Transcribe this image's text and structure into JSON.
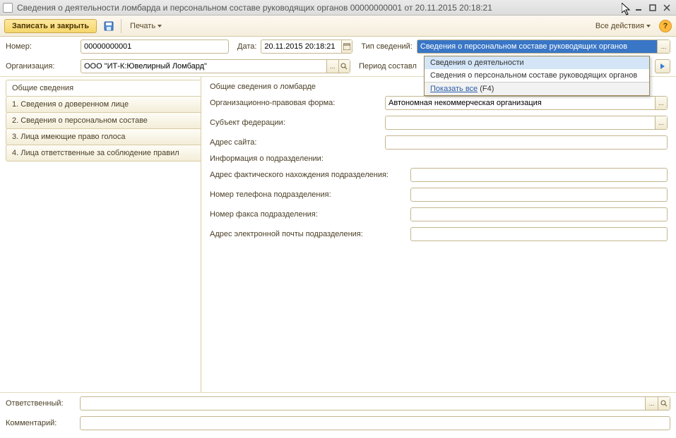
{
  "title": "Сведения о деятельности ломбарда и персональном составе руководящих органов 00000000001 от 20.11.2015 20:18:21",
  "toolbar": {
    "save_close": "Записать и закрыть",
    "print": "Печать",
    "all_actions": "Все действия"
  },
  "filters": {
    "number_label": "Номер:",
    "number_value": "00000000001",
    "date_label": "Дата:",
    "date_value": "20.11.2015 20:18:21",
    "type_label": "Тип сведений:",
    "type_value": "Сведения о персональном составе руководящих органов",
    "org_label": "Организация:",
    "org_value": "ООО \"ИТ-К:Ювелирный Ломбард\"",
    "period_label": "Период составл"
  },
  "tabs": [
    {
      "label": "Общие сведения"
    },
    {
      "label": "1. Сведения о доверенном лице"
    },
    {
      "label": "2. Сведения о персональном составе"
    },
    {
      "label": "3. Лица имеющие право голоса"
    },
    {
      "label": "4. Лица ответственные за соблюдение правил"
    }
  ],
  "form": {
    "header": "Общие сведения о ломбарде",
    "org_form_label": "Организационно-правовая форма:",
    "org_form_value": "Автономная некоммерческая организация",
    "subject_label": "Субъект федерации:",
    "site_label": "Адрес сайта:",
    "div_info": "Информация о подразделении:",
    "div_addr_label": "Адрес фактического нахождения подразделения:",
    "div_phone_label": "Номер телефона подразделения:",
    "div_fax_label": "Номер факса подразделения:",
    "div_email_label": "Адрес электронной почты подразделения:"
  },
  "footer": {
    "resp_label": "Ответственный:",
    "comment_label": "Комментарий:"
  },
  "popup": {
    "item1": "Сведения о деятельности",
    "item2": "Сведения о персональном составе руководящих органов",
    "show_all": "Показать все",
    "show_all_key": "(F4)"
  }
}
